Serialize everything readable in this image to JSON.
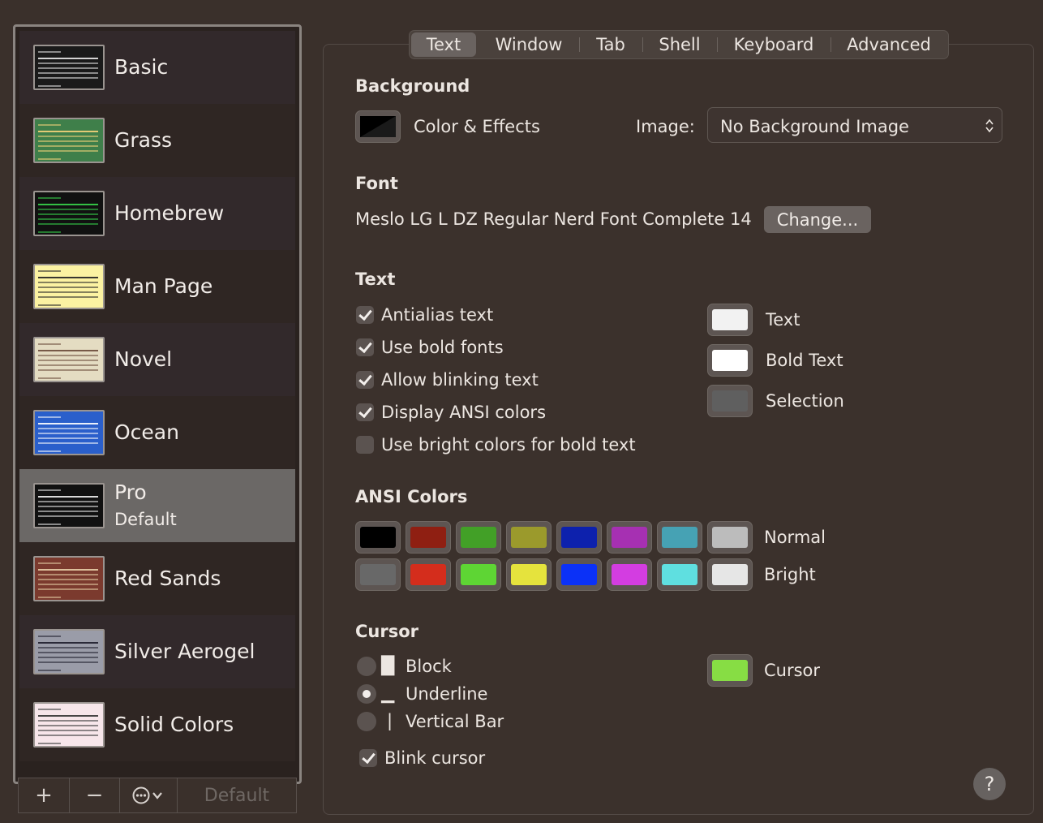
{
  "sidebar": {
    "profiles": [
      {
        "name": "Basic",
        "bg": "#1a1a1a",
        "fg": "#e8e8e8"
      },
      {
        "name": "Grass",
        "bg": "#3f7f4a",
        "fg": "#f4d37a"
      },
      {
        "name": "Homebrew",
        "bg": "#111111",
        "fg": "#37d34a"
      },
      {
        "name": "Man Page",
        "bg": "#fbf2a2",
        "fg": "#222222"
      },
      {
        "name": "Novel",
        "bg": "#e4dcc2",
        "fg": "#6a4a3a"
      },
      {
        "name": "Ocean",
        "bg": "#2a5fcb",
        "fg": "#ffffff"
      },
      {
        "name": "Pro",
        "sub": "Default",
        "bg": "#111111",
        "fg": "#f0f0f0"
      },
      {
        "name": "Red Sands",
        "bg": "#7b3a2e",
        "fg": "#e8cfa8"
      },
      {
        "name": "Silver Aerogel",
        "bg": "#9a9ca8",
        "fg": "#1d1d2a"
      },
      {
        "name": "Solid Colors",
        "bg": "#f7e6ea",
        "fg": "#333333"
      }
    ],
    "footer": {
      "add_label": "+",
      "remove_label": "−",
      "default_label": "Default"
    }
  },
  "tabs": [
    {
      "label": "Text",
      "active": true
    },
    {
      "label": "Window"
    },
    {
      "label": "Tab"
    },
    {
      "label": "Shell"
    },
    {
      "label": "Keyboard"
    },
    {
      "label": "Advanced"
    }
  ],
  "background": {
    "heading": "Background",
    "color_effects_label": "Color & Effects",
    "image_label": "Image:",
    "image_value": "No Background Image"
  },
  "font": {
    "heading": "Font",
    "value": "Meslo LG L DZ Regular Nerd Font Complete 14",
    "change_label": "Change..."
  },
  "text": {
    "heading": "Text",
    "options": [
      {
        "label": "Antialias text",
        "checked": true
      },
      {
        "label": "Use bold fonts",
        "checked": true
      },
      {
        "label": "Allow blinking text",
        "checked": true
      },
      {
        "label": "Display ANSI colors",
        "checked": true
      },
      {
        "label": "Use bright colors for bold text",
        "checked": false
      }
    ],
    "colors": [
      {
        "label": "Text",
        "color": "#f2f2f2"
      },
      {
        "label": "Bold Text",
        "color": "#ffffff"
      },
      {
        "label": "Selection",
        "color": "#5f5f5f"
      }
    ]
  },
  "ansi": {
    "heading": "ANSI Colors",
    "normal_label": "Normal",
    "bright_label": "Bright",
    "normal": [
      "#000000",
      "#8f1f12",
      "#42a027",
      "#9b9a2c",
      "#0d21ad",
      "#a630b2",
      "#46a2b4",
      "#bcbcbc"
    ],
    "bright": [
      "#686868",
      "#d42d1c",
      "#5ed534",
      "#e5e33d",
      "#0b31f7",
      "#d33de1",
      "#5fdfe0",
      "#e6e6e6"
    ]
  },
  "cursor": {
    "heading": "Cursor",
    "options": [
      {
        "label": "Block",
        "glyph": "█",
        "selected": false
      },
      {
        "label": "Underline",
        "glyph": "▁",
        "selected": true
      },
      {
        "label": "Vertical Bar",
        "glyph": "|",
        "selected": false
      }
    ],
    "blink_label": "Blink cursor",
    "blink_checked": true,
    "color_label": "Cursor",
    "color": "#87dd44"
  },
  "help_label": "?"
}
